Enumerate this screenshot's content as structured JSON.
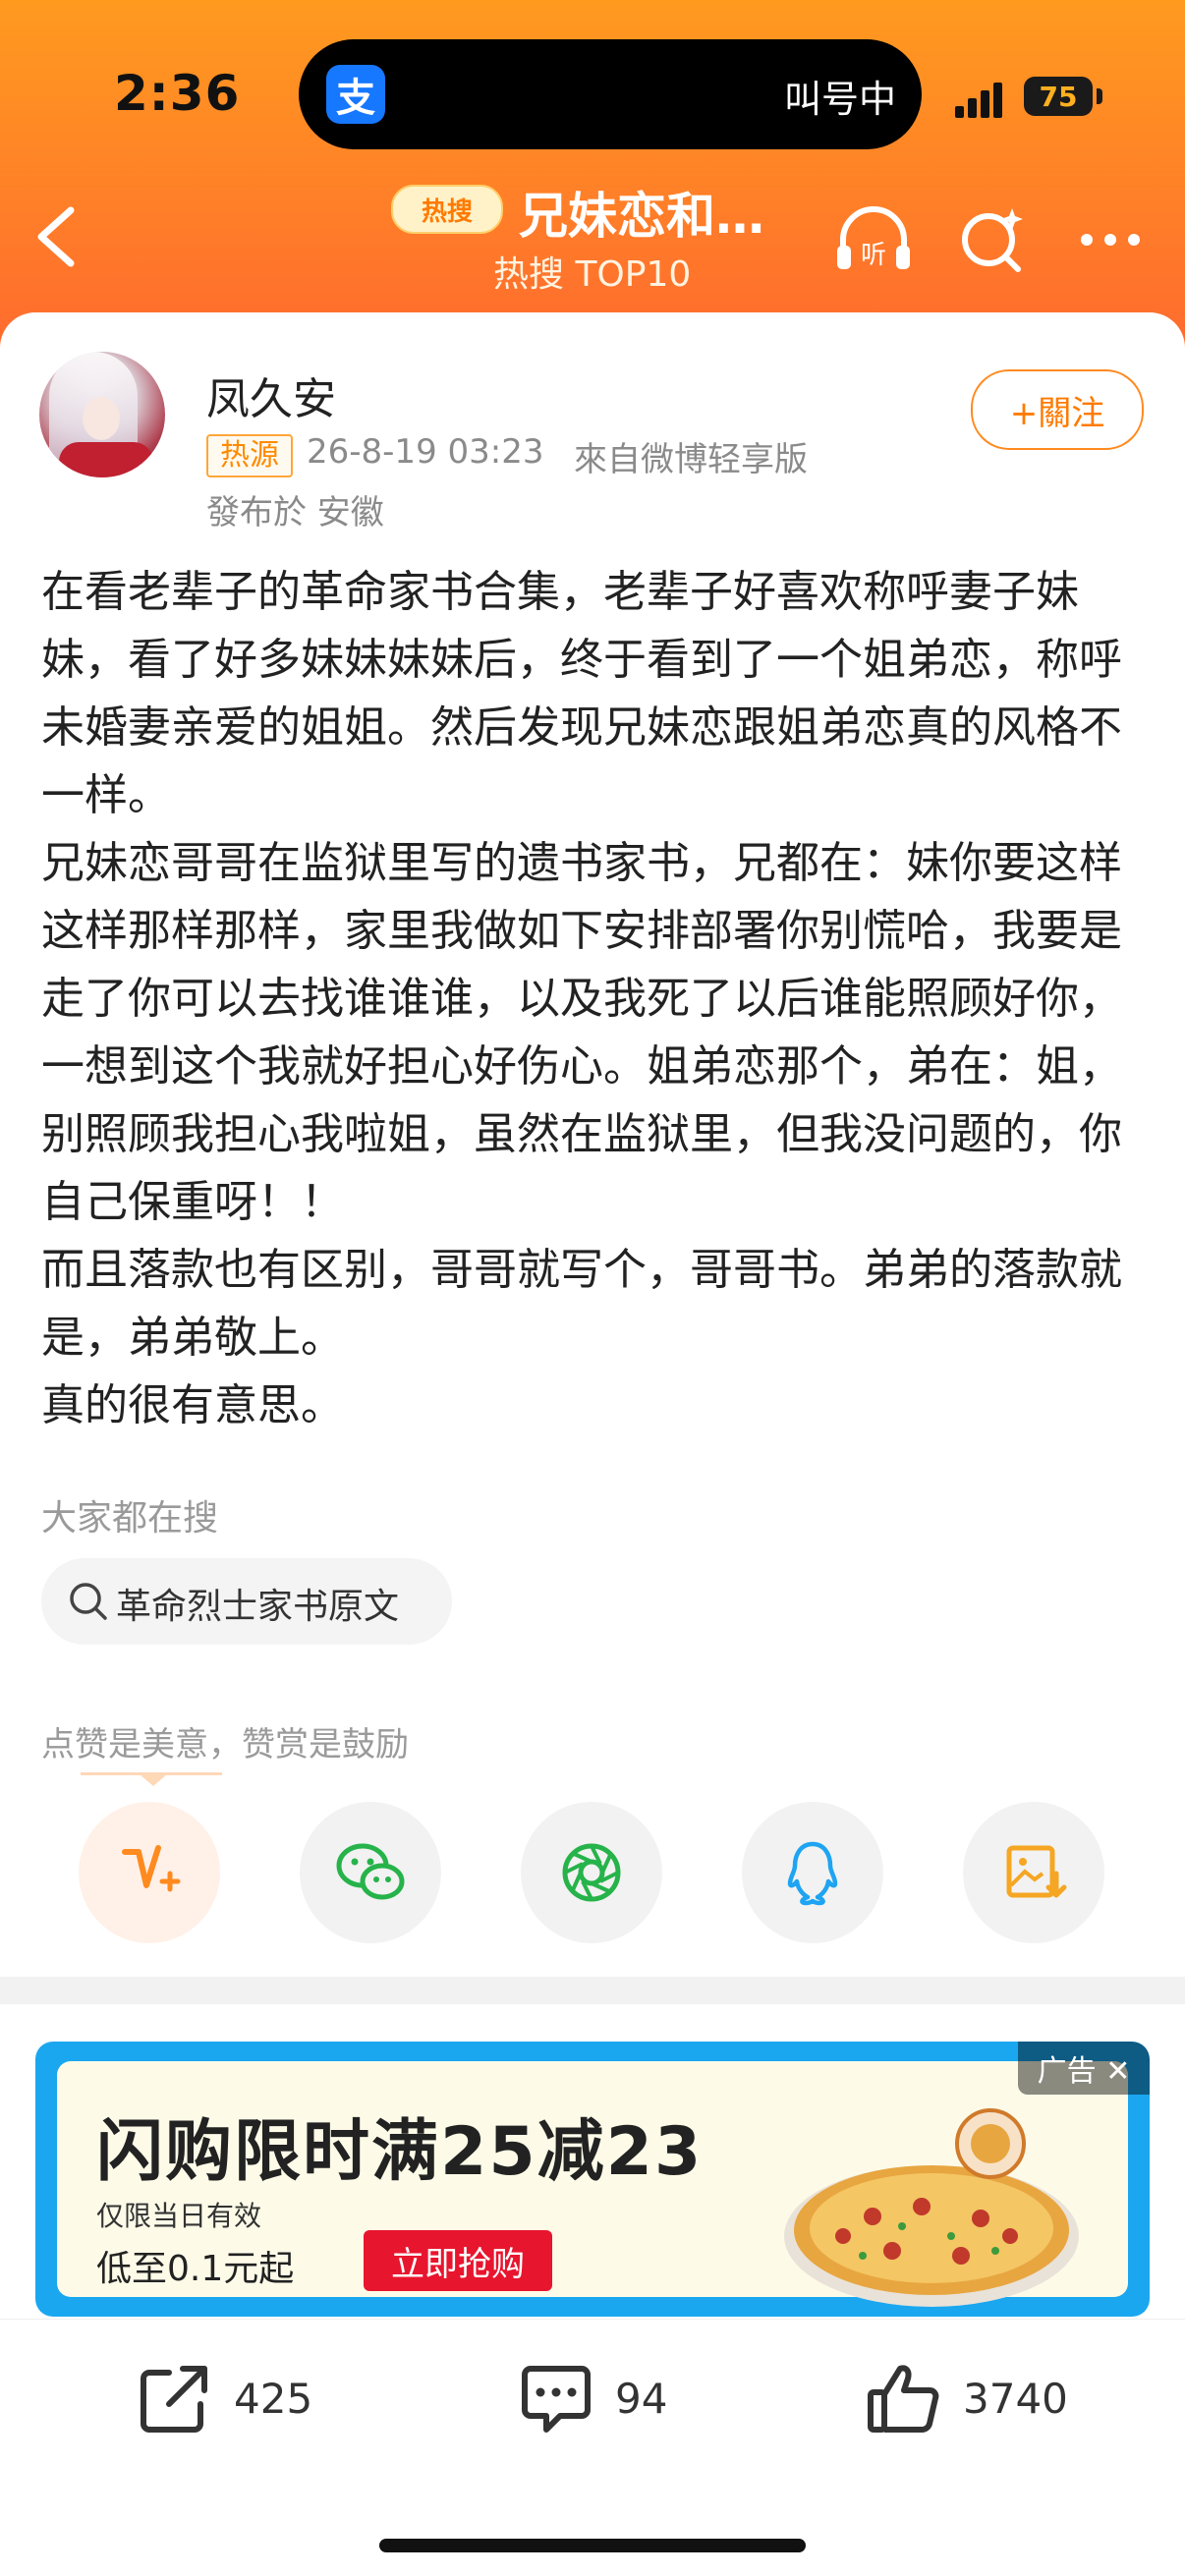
{
  "status_bar": {
    "time": "2:36",
    "island_app_icon": "支",
    "island_text": "叫号中",
    "battery": "75"
  },
  "nav": {
    "hot_badge": "热搜",
    "title": "兄妹恋和…",
    "subtitle": "热搜 TOP10",
    "icons": [
      "back-icon",
      "headphone-listen-icon",
      "search-sparkle-icon",
      "more-icon"
    ],
    "listen_label": "听"
  },
  "post": {
    "username": "凤久安",
    "tag": "热源",
    "time": "26-8-19 03:23",
    "source": "來自微博轻享版",
    "location": "發布於 安徽",
    "follow_label": "+關注",
    "paragraphs": [
      "在看老辈子的革命家书合集，老辈子好喜欢称呼妻子妹妹，看了好多妹妹妹妹后，终于看到了一个姐弟恋，称呼未婚妻亲爱的姐姐。然后发现兄妹恋跟姐弟恋真的风格不一样。",
      "兄妹恋哥哥在监狱里写的遗书家书，兄都在：妹你要这样这样那样那样，家里我做如下安排部署你别慌哈，我要是走了你可以去找谁谁谁，以及我死了以后谁能照顾好你，一想到这个我就好担心好伤心。姐弟恋那个，弟在：姐，别照顾我担心我啦姐，虽然在监狱里，但我没问题的，你自己保重呀！！",
      "而且落款也有区别，哥哥就写个，哥哥书。弟弟的落款就是，弟弟敬上。",
      "真的很有意思。"
    ]
  },
  "related": {
    "label": "大家都在搜",
    "chip": "革命烈士家书原文"
  },
  "reward": {
    "tip": "点赞是美意，赞赏是鼓励"
  },
  "share_icons": [
    "reward-v-icon",
    "wechat-icon",
    "moments-icon",
    "qq-icon",
    "save-image-icon"
  ],
  "ad": {
    "title": "闪购限时满25减23",
    "sub": "仅限当日有效",
    "price": "低至0.1元起",
    "button": "立即抢购",
    "tag": "广告 ✕"
  },
  "actions": {
    "share_count": "425",
    "comment_count": "94",
    "like_count": "3740"
  },
  "colors": {
    "header_orange": "#ff8526",
    "accent": "#ff7a00",
    "ad_blue": "#1aa7f0",
    "ad_red": "#e8152e"
  }
}
